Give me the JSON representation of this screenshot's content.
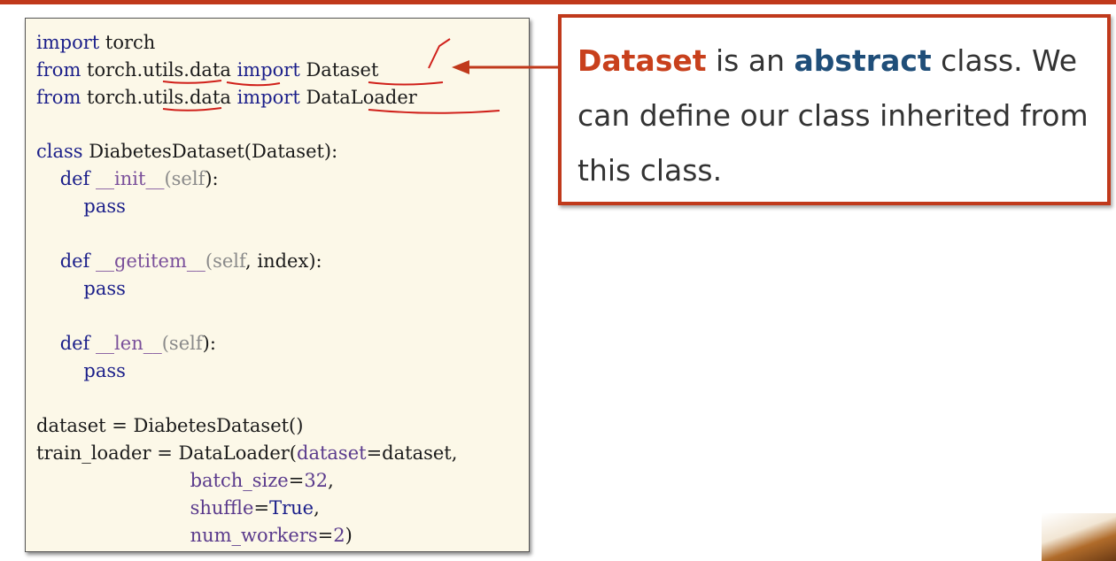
{
  "code": {
    "line1": {
      "kw": "import",
      "rest": " torch"
    },
    "line2": {
      "kw1": "from",
      "mod": " torch.utils.data ",
      "kw2": "import",
      "name": " Dataset"
    },
    "line3": {
      "kw1": "from",
      "mod": " torch.utils.data ",
      "kw2": "import",
      "name": " DataLoader"
    },
    "line4": {
      "kw": "class",
      "rest": " DiabetesDataset(Dataset):"
    },
    "line5": {
      "indent": "    ",
      "kw": "def",
      "sp": " ",
      "fn": "__init__",
      "open": "(",
      "self": "self",
      "close": "):"
    },
    "line6": {
      "indent": "        ",
      "kw": "pass"
    },
    "line7": {
      "indent": "    ",
      "kw": "def",
      "sp": " ",
      "fn": "__getitem__",
      "open": "(",
      "self": "self",
      "close": ", index):"
    },
    "line8": {
      "indent": "        ",
      "kw": "pass"
    },
    "line9": {
      "indent": "    ",
      "kw": "def",
      "sp": " ",
      "fn": "__len__",
      "open": "(",
      "self": "self",
      "close": "):"
    },
    "line10": {
      "indent": "        ",
      "kw": "pass"
    },
    "line11": {
      "text": "dataset = DiabetesDataset()"
    },
    "line12": {
      "pre": "train_loader = DataLoader(",
      "arg": "dataset",
      "post": "=dataset,"
    },
    "line13": {
      "indent": "                          ",
      "arg": "batch_size",
      "eq": "=",
      "num": "32",
      "post": ","
    },
    "line14": {
      "indent": "                          ",
      "arg": "shuffle",
      "eq": "=",
      "val": "True",
      "post": ","
    },
    "line15": {
      "indent": "                          ",
      "arg": "num_workers",
      "eq": "=",
      "num": "2",
      "post": ")"
    }
  },
  "callout": {
    "word1": "Dataset",
    "text1": " is an ",
    "word2": "abstract",
    "text2": " class. We can define our class inherited from this class."
  },
  "colors": {
    "accent_red": "#c0391b",
    "code_background": "#fcf8e8",
    "keyword_blue": "#1b1f8a",
    "abstract_blue": "#1f4e79"
  }
}
